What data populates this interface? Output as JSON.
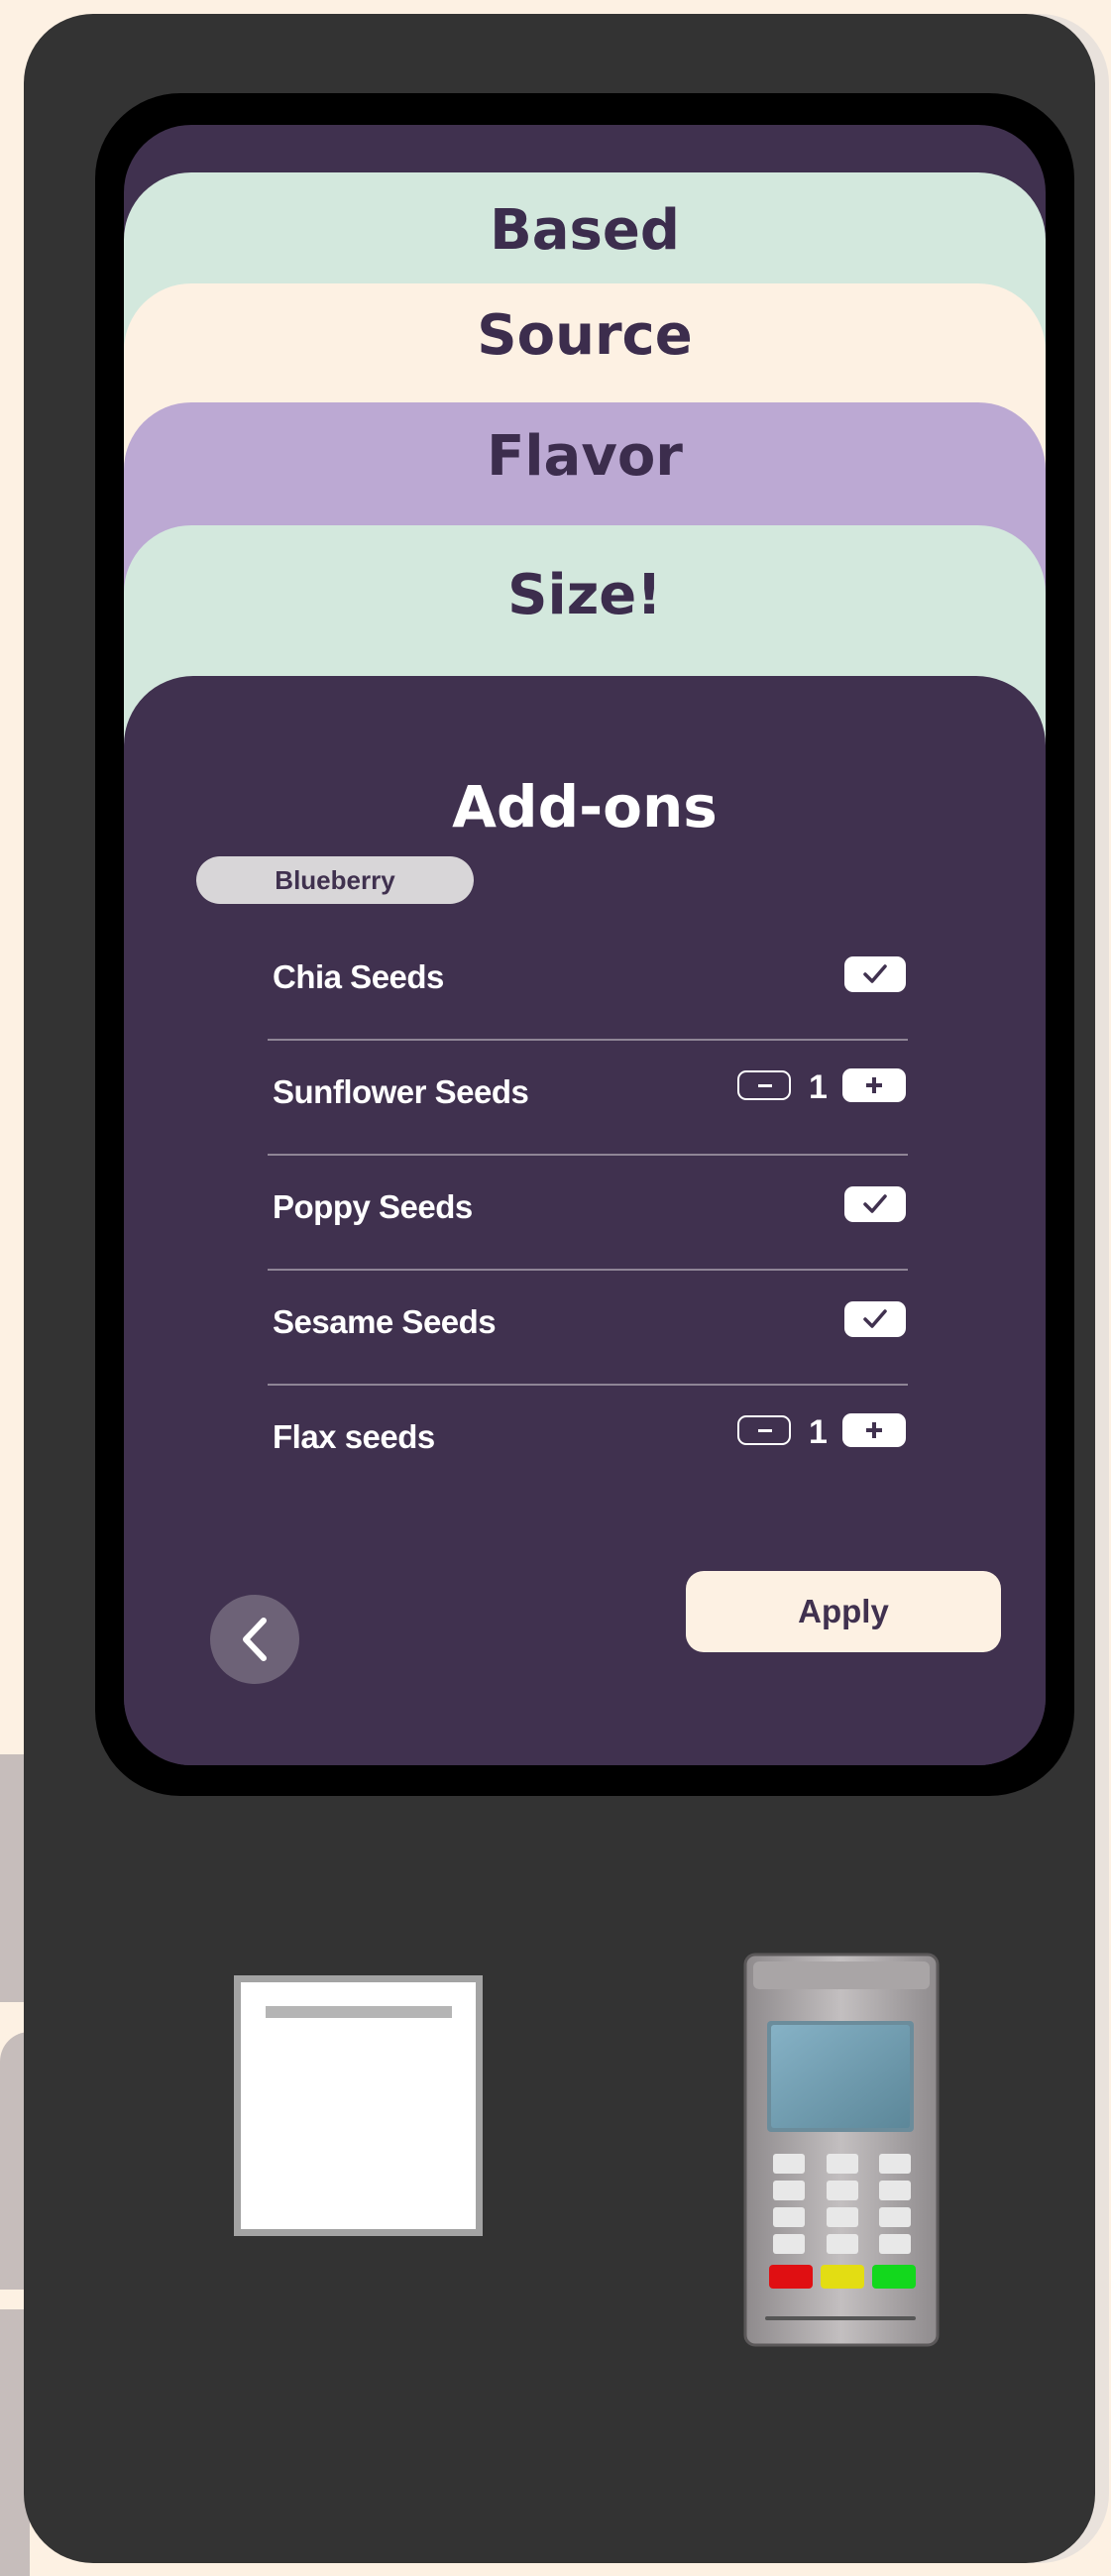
{
  "steps": {
    "based": "Based",
    "source": "Source",
    "flavor": "Flavor",
    "size": "Size!"
  },
  "panel": {
    "title": "Add-ons",
    "selected_flavor": "Blueberry"
  },
  "addons": [
    {
      "name": "Chia Seeds",
      "control": "checkbox",
      "checked": true
    },
    {
      "name": "Sunflower Seeds",
      "control": "stepper",
      "quantity": "1"
    },
    {
      "name": "Poppy Seeds",
      "control": "checkbox",
      "checked": true
    },
    {
      "name": "Sesame Seeds",
      "control": "checkbox",
      "checked": true
    },
    {
      "name": "Flax seeds",
      "control": "stepper",
      "quantity": "1"
    }
  ],
  "actions": {
    "apply_label": "Apply",
    "back_icon": "chevron-left-icon"
  },
  "hardware": {
    "receipt_printer_icon": "receipt-slot",
    "card_reader_icon": "card-reader"
  },
  "colors": {
    "background": "#fdf1e3",
    "kiosk_body": "#333333",
    "panel": "#40314f",
    "mint": "#d3e8dd",
    "lavender": "#bca9d3",
    "cream": "#fdf1e3"
  }
}
